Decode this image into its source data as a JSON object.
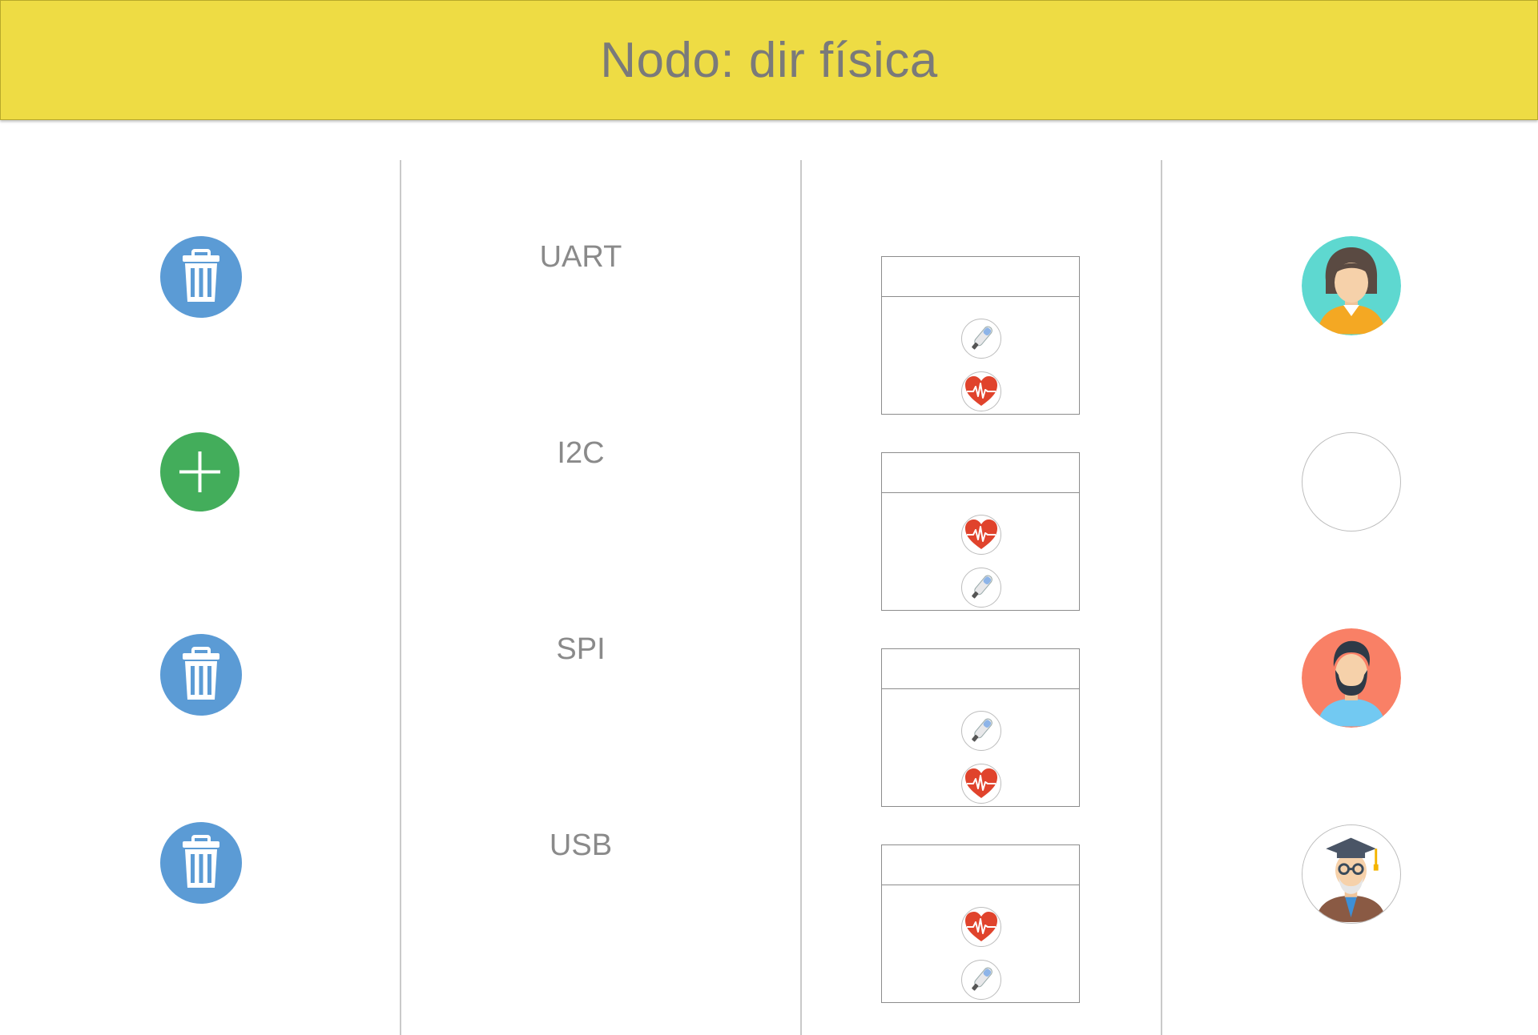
{
  "header": {
    "title": "Nodo: dir física"
  },
  "rows": [
    {
      "interface": "UART",
      "action": "delete",
      "action_icon": "trash-icon",
      "sensors": [
        "thermometer-icon",
        "heart-rate-icon"
      ],
      "avatar": "woman-avatar-icon"
    },
    {
      "interface": "I2C",
      "action": "add",
      "action_icon": "plus-icon",
      "sensors": [
        "heart-rate-icon",
        "thermometer-icon"
      ],
      "avatar": "empty-avatar"
    },
    {
      "interface": "SPI",
      "action": "delete",
      "action_icon": "trash-icon",
      "sensors": [
        "thermometer-icon",
        "heart-rate-icon"
      ],
      "avatar": "bearded-man-avatar-icon"
    },
    {
      "interface": "USB",
      "action": "delete",
      "action_icon": "trash-icon",
      "sensors": [
        "heart-rate-icon",
        "thermometer-icon"
      ],
      "avatar": "professor-avatar-icon"
    }
  ],
  "colors": {
    "header_bg": "#eedc44",
    "delete_button": "#5b9bd5",
    "add_button": "#43ad5b",
    "heart": "#e0432c",
    "text": "#8a8a8a"
  }
}
